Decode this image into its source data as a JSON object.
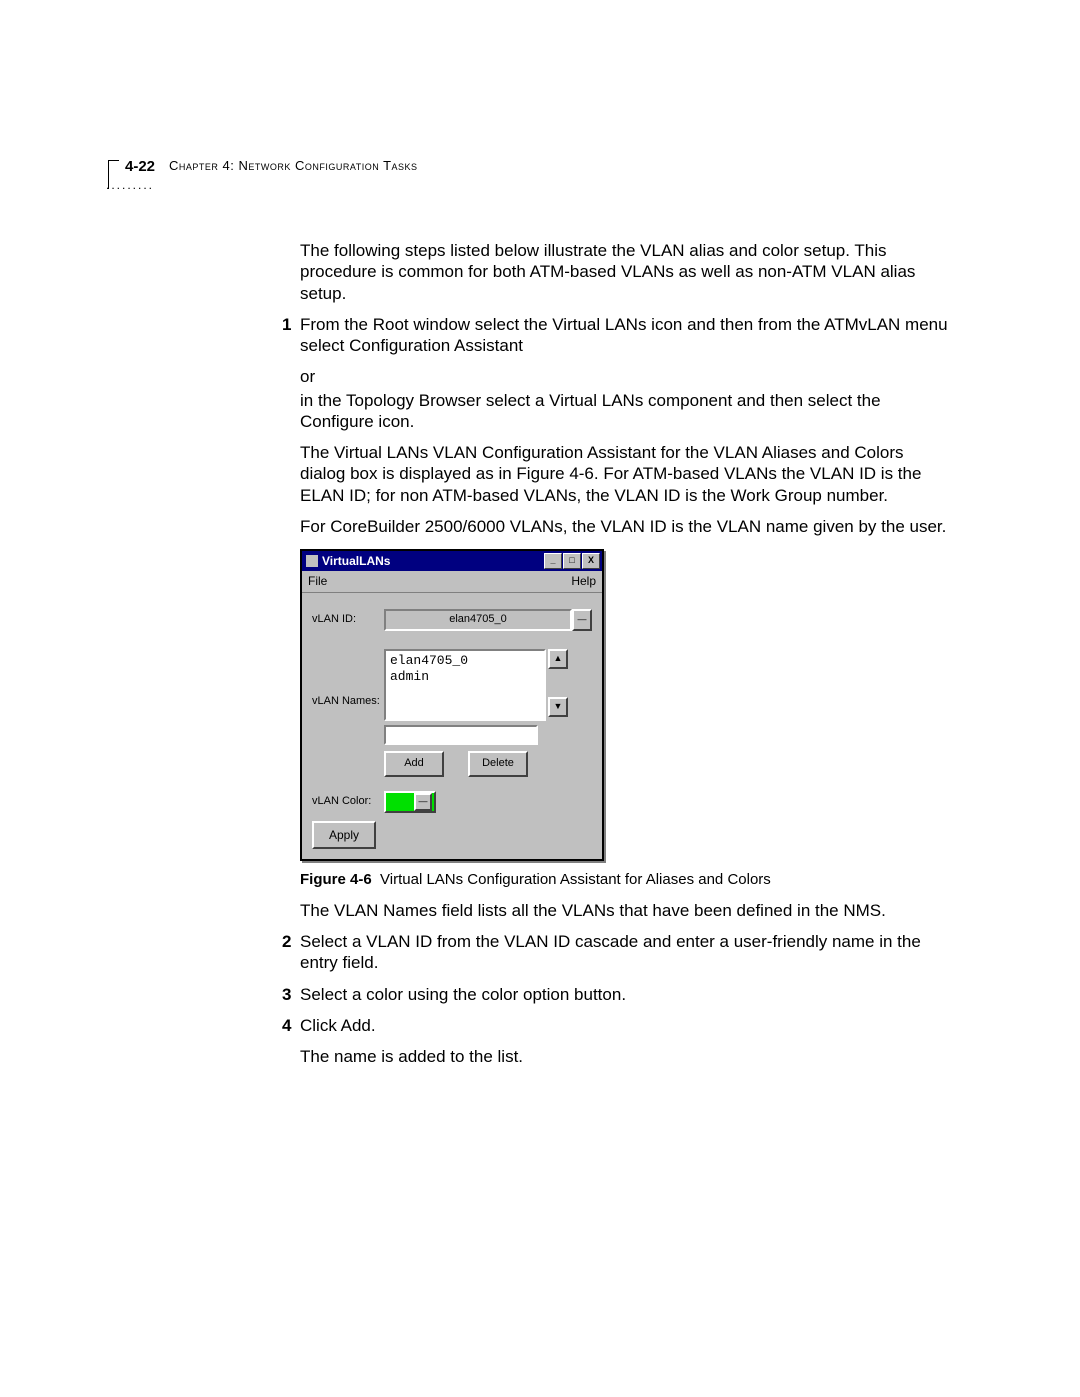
{
  "header": {
    "page_number": "4-22",
    "chapter_label": "Chapter 4: Network Configuration Tasks",
    "dots": "........."
  },
  "intro_paragraph": "The following steps listed below illustrate the VLAN alias and color setup. This procedure is common for both ATM-based VLANs as well as non-ATM VLAN alias setup.",
  "step1": {
    "num": "1",
    "p1": "From the Root window select the Virtual LANs icon and then from the ATMvLAN menu select Configuration Assistant",
    "or": "or",
    "p2": "in the Topology Browser select a Virtual LANs component and then select the Configure icon.",
    "p3": "The Virtual LANs VLAN Configuration Assistant for the VLAN Aliases and Colors dialog box is displayed as in Figure 4-6. For ATM-based VLANs the VLAN ID is the ELAN ID; for non ATM-based VLANs, the VLAN ID is the Work Group number.",
    "p4": "For CoreBuilder 2500/6000 VLANs, the VLAN ID is the VLAN name given by the user."
  },
  "dialog": {
    "title": "VirtualLANs",
    "menu_file": "File",
    "menu_help": "Help",
    "label_vlanid": "vLAN ID:",
    "vlanid_value": "elan4705_0",
    "label_vlannames": "vLAN Names:",
    "list_item_1": "elan4705_0",
    "list_item_2": "admin",
    "btn_add": "Add",
    "btn_delete": "Delete",
    "label_vlancolor": "vLAN Color:",
    "btn_apply": "Apply",
    "winbtn_min": "_",
    "winbtn_max": "□",
    "winbtn_close": "X",
    "scroll_up": "▲",
    "scroll_down": "▼",
    "dd": "—"
  },
  "figure": {
    "label": "Figure 4-6",
    "caption": "Virtual LANs Configuration Assistant for Aliases and Colors"
  },
  "after_figure": "The VLAN Names field lists all the VLANs that have been defined in the NMS.",
  "step2": {
    "num": "2",
    "text": "Select a VLAN ID from the VLAN ID cascade and enter a user-friendly name in the entry field."
  },
  "step3": {
    "num": "3",
    "text": "Select a color using the color option button."
  },
  "step4": {
    "num": "4",
    "text": "Click Add.",
    "after": "The name is added to the list."
  }
}
